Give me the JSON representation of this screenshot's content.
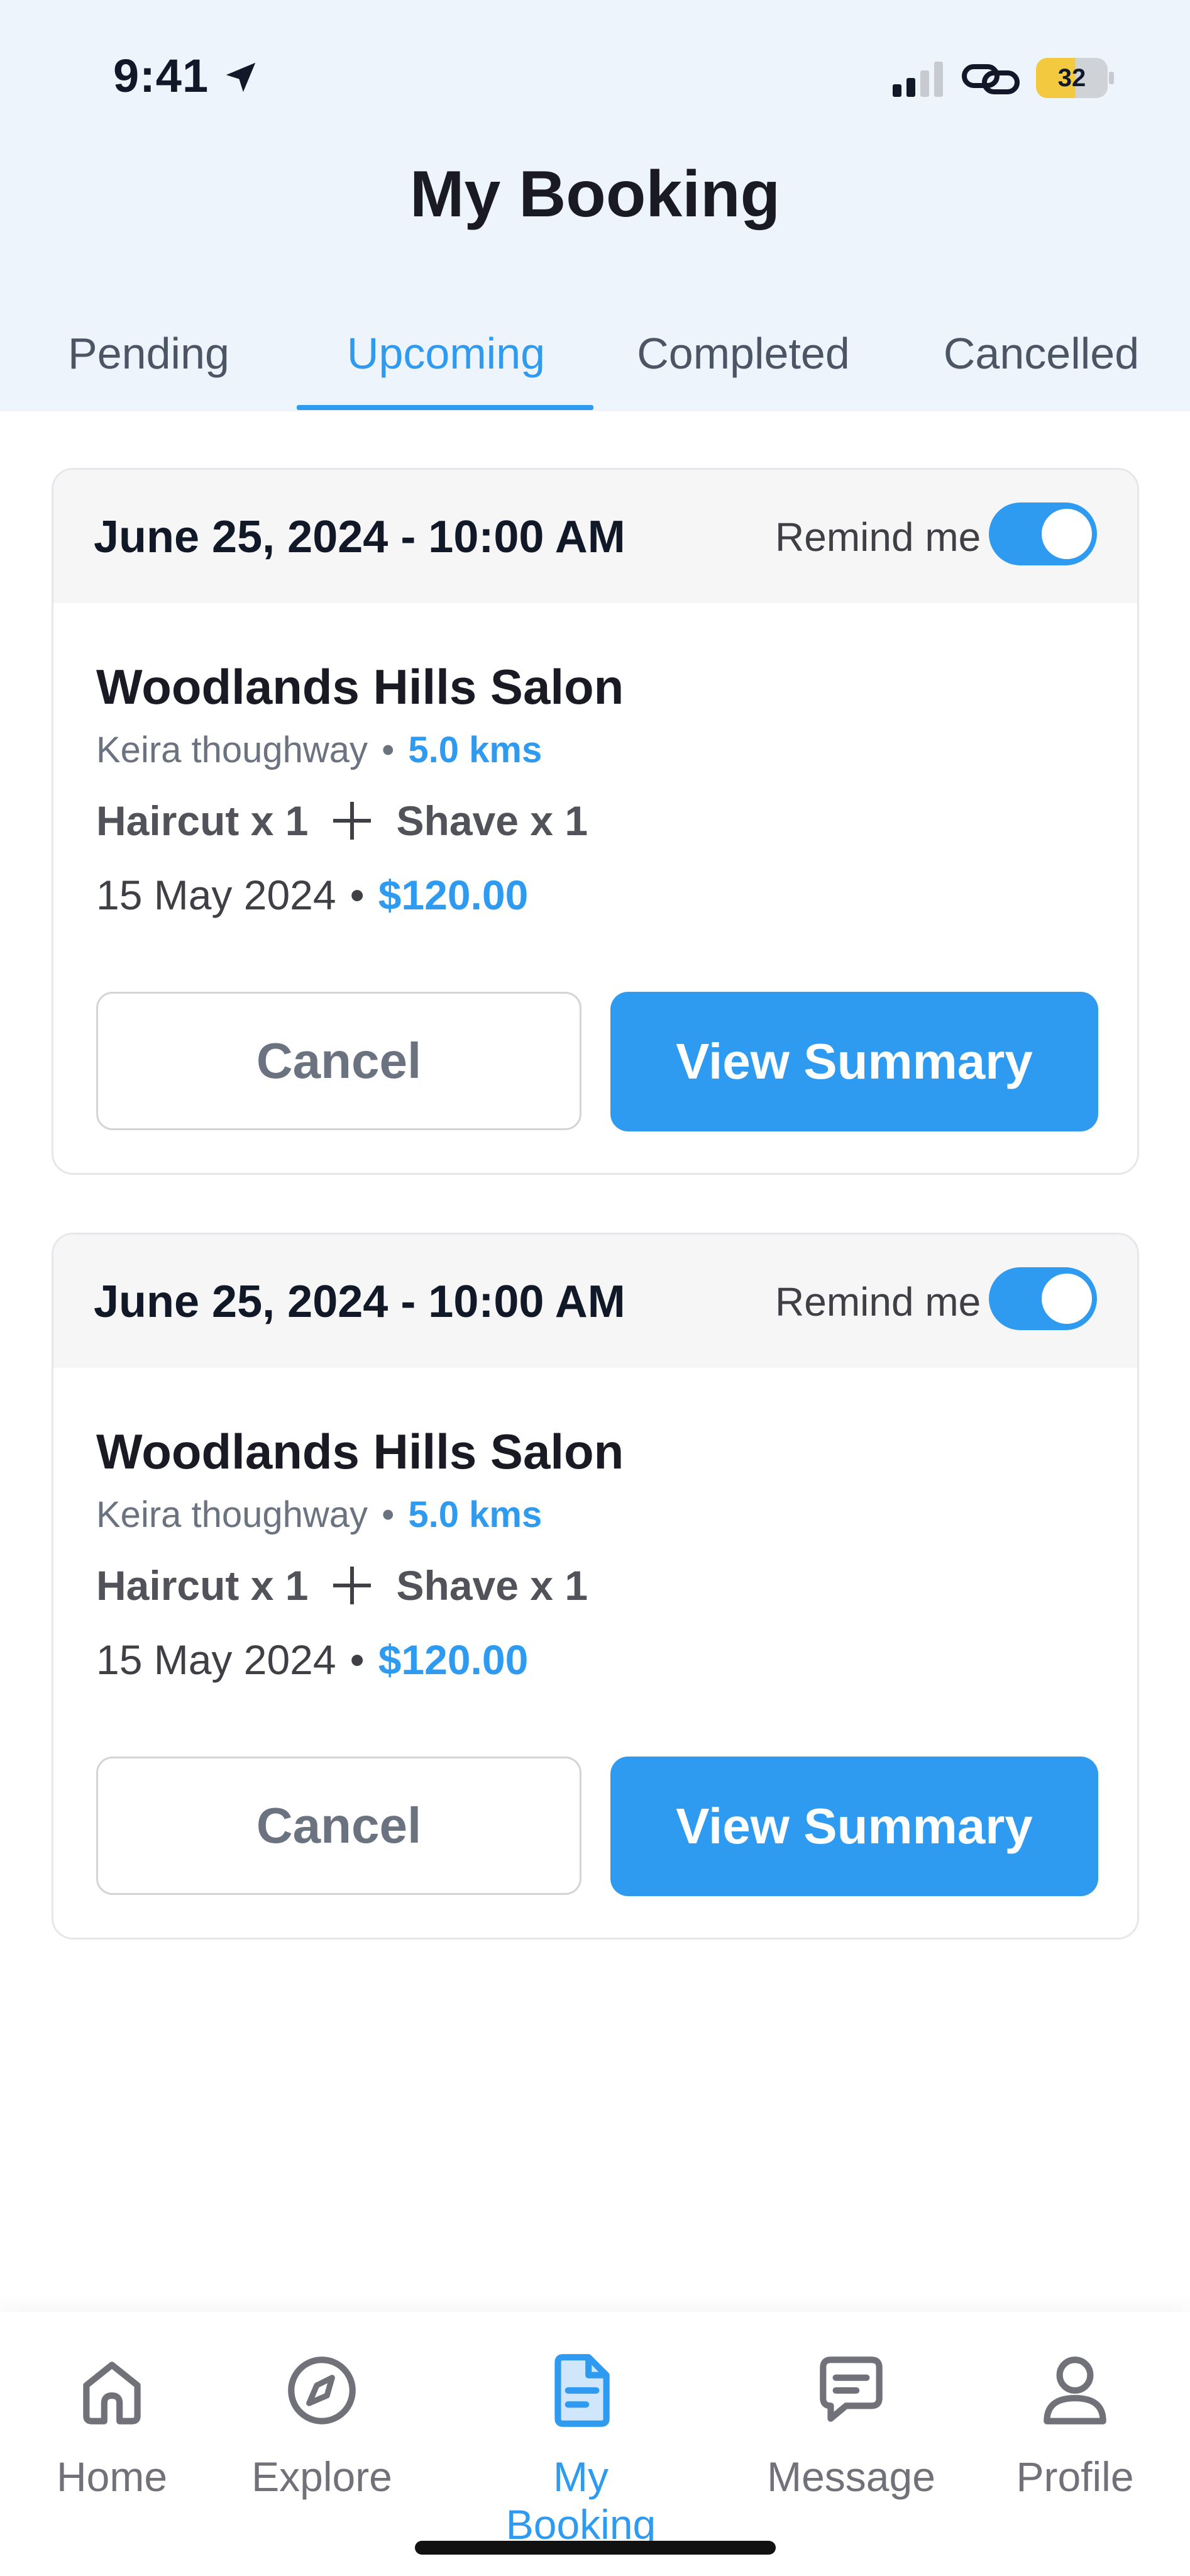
{
  "status_bar": {
    "time": "9:41",
    "battery": "32"
  },
  "header": {
    "title": "My Booking"
  },
  "tabs": [
    {
      "label": "Pending",
      "active": false
    },
    {
      "label": "Upcoming",
      "active": true
    },
    {
      "label": "Completed",
      "active": false
    },
    {
      "label": "Cancelled",
      "active": false
    }
  ],
  "bookings": [
    {
      "datetime": "June 25, 2024 - 10:00 AM",
      "remind_label": "Remind me",
      "remind_on": true,
      "salon": "Woodlands Hills Salon",
      "stylist": "Keira thoughway",
      "distance": "5.0 kms",
      "service_1": "Haircut x 1",
      "service_2": "Shave x 1",
      "date": "15 May 2024",
      "price": "$120.00",
      "cancel_label": "Cancel",
      "summary_label": "View Summary"
    },
    {
      "datetime": "June 25, 2024 - 10:00 AM",
      "remind_label": "Remind me",
      "remind_on": true,
      "salon": "Woodlands Hills Salon",
      "stylist": "Keira thoughway",
      "distance": "5.0 kms",
      "service_1": "Haircut x 1",
      "service_2": "Shave x 1",
      "date": "15 May 2024",
      "price": "$120.00",
      "cancel_label": "Cancel",
      "summary_label": "View Summary"
    }
  ],
  "bottom_nav": [
    {
      "label": "Home",
      "icon": "home-icon",
      "active": false
    },
    {
      "label": "Explore",
      "icon": "compass-icon",
      "active": false
    },
    {
      "label": "My Booking",
      "icon": "booking-document-icon",
      "active": true
    },
    {
      "label": "Message",
      "icon": "message-icon",
      "active": false
    },
    {
      "label": "Profile",
      "icon": "profile-icon",
      "active": false
    }
  ],
  "colors": {
    "accent": "#2f9bf0",
    "header_bg": "#eef4fc",
    "card_head_bg": "#f6f6f7"
  }
}
